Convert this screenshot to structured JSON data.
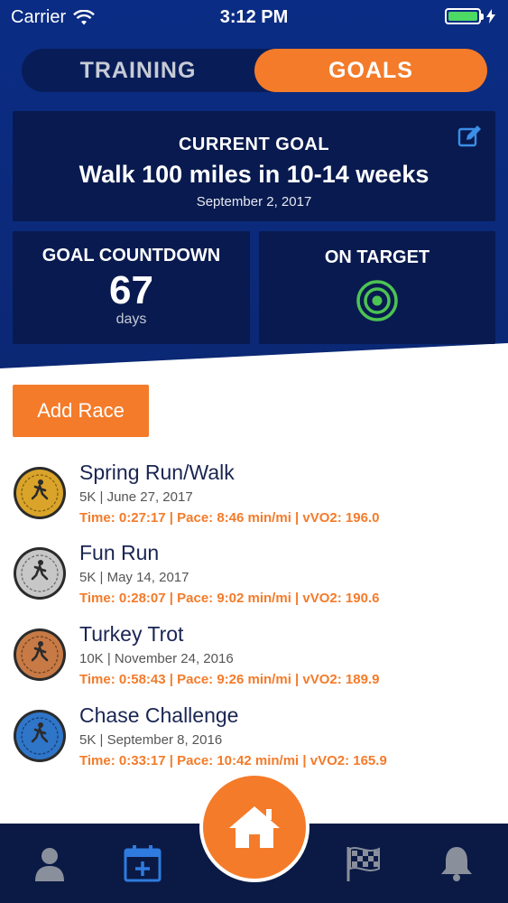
{
  "status_bar": {
    "carrier": "Carrier",
    "time": "3:12 PM",
    "battery_icon": "battery-full-icon",
    "wifi_icon": "wifi-icon",
    "charging_icon": "bolt-icon"
  },
  "segmented_control": {
    "tabs": [
      {
        "label": "TRAINING",
        "selected": false
      },
      {
        "label": "GOALS",
        "selected": true
      }
    ]
  },
  "current_goal": {
    "label": "CURRENT GOAL",
    "title": "Walk 100 miles in 10-14 weeks",
    "date": "September 2, 2017",
    "edit_icon": "edit-icon"
  },
  "countdown": {
    "label": "GOAL COUNTDOWN",
    "value": "67",
    "unit": "days"
  },
  "target": {
    "label": "ON TARGET",
    "icon": "target-icon",
    "color": "#4cc352"
  },
  "add_race_label": "Add Race",
  "races": [
    {
      "name": "Spring Run/Walk",
      "meta": "5K | June 27, 2017",
      "stats": "Time: 0:27:17 | Pace: 8:46 min/mi | vVO2: 196.0",
      "medal": "gold-medal-icon",
      "medal_color": "#d9a429"
    },
    {
      "name": "Fun Run",
      "meta": "5K | May 14, 2017",
      "stats": "Time: 0:28:07 | Pace: 9:02 min/mi | vVO2: 190.6",
      "medal": "silver-medal-icon",
      "medal_color": "#c7c7c7"
    },
    {
      "name": "Turkey Trot",
      "meta": "10K | November 24, 2016",
      "stats": "Time: 0:58:43 | Pace: 9:26 min/mi | vVO2: 189.9",
      "medal": "bronze-medal-icon",
      "medal_color": "#c77a45"
    },
    {
      "name": "Chase Challenge",
      "meta": "5K | September 8, 2016",
      "stats": "Time: 0:33:17 | Pace: 10:42 min/mi | vVO2: 165.9",
      "medal": "blue-medal-icon",
      "medal_color": "#2f75c8"
    }
  ],
  "tabbar": {
    "items": [
      "profile-icon",
      "calendar-add-icon",
      "home-icon",
      "checkered-flag-icon",
      "bell-icon"
    ],
    "active_color": "#2f7be0",
    "accent": "#f47b2a"
  }
}
